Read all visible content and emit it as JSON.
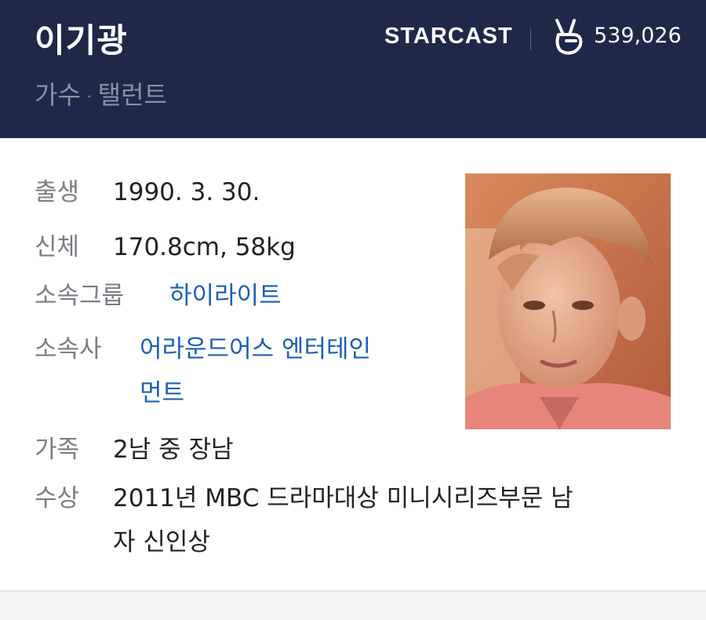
{
  "header": {
    "name": "이기광",
    "roles": [
      "가수",
      "탤런트"
    ],
    "brand": "STARCAST",
    "vote_icon": "v-hand-icon",
    "vote_count": "539,026"
  },
  "profile": {
    "birth": {
      "label": "출생",
      "value": "1990. 3. 30."
    },
    "body": {
      "label": "신체",
      "value": "170.8cm, 58kg"
    },
    "group": {
      "label": "소속그룹",
      "value": "하이라이트"
    },
    "agency": {
      "label": "소속사",
      "value_line1": "어라운드어스 엔터테인",
      "value_line2": "먼트"
    },
    "family": {
      "label": "가족",
      "value": "2남 중 장남"
    },
    "award": {
      "label": "수상",
      "value_line1": "2011년 MBC 드라마대상 미니시리즈부문 남",
      "value_line2": "자 신인상"
    }
  },
  "colors": {
    "header_bg": "#1f2848",
    "link": "#1e5fb0"
  }
}
